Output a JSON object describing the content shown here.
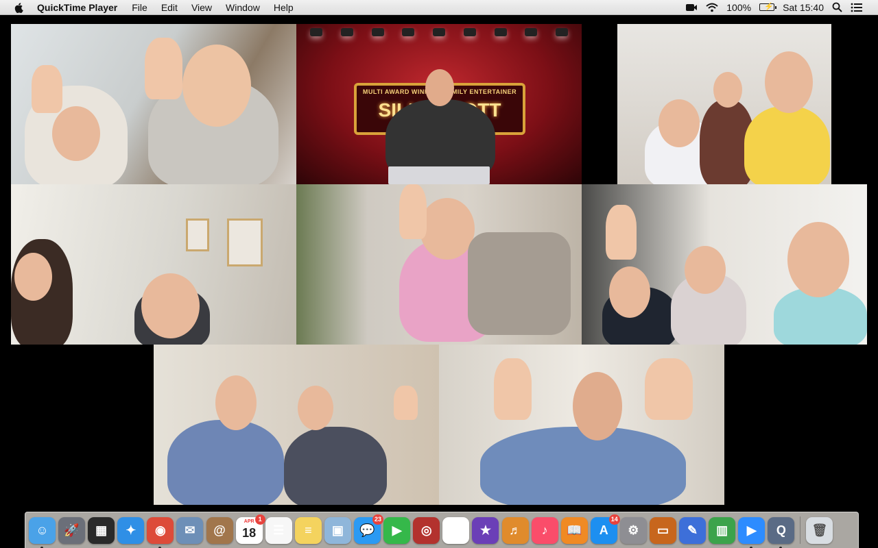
{
  "menubar": {
    "app_name": "QuickTime Player",
    "menus": [
      "File",
      "Edit",
      "View",
      "Window",
      "Help"
    ],
    "battery_percent": "100%",
    "clock": "Sat 15:40"
  },
  "video_tiles": {
    "entertainer_banner_line1": "MULTI AWARD WINNING FAMILY ENTERTAINER",
    "entertainer_banner_line2": "SILLY SCOTT"
  },
  "dock": {
    "items": [
      {
        "name": "finder-icon",
        "color": "#4aa2e8",
        "glyph": "☺",
        "running": true
      },
      {
        "name": "launchpad-icon",
        "color": "#6b6f79",
        "glyph": "🚀",
        "running": false
      },
      {
        "name": "mission-control-icon",
        "color": "#2a2a2a",
        "glyph": "▦",
        "running": false
      },
      {
        "name": "safari-icon",
        "color": "#2f8fe6",
        "glyph": "✦",
        "running": false
      },
      {
        "name": "chrome-icon",
        "color": "#dd4b39",
        "glyph": "◉",
        "running": true
      },
      {
        "name": "mail-stamp-icon",
        "color": "#6d8fb7",
        "glyph": "✉",
        "running": false
      },
      {
        "name": "contacts-icon",
        "color": "#a1764c",
        "glyph": "@",
        "running": false
      },
      {
        "name": "calendar-icon",
        "color": "#ffffff",
        "glyph": "",
        "running": false,
        "badge": "1"
      },
      {
        "name": "reminders-icon",
        "color": "#f7f7f7",
        "glyph": "☰",
        "running": false
      },
      {
        "name": "notes-icon",
        "color": "#f4d35e",
        "glyph": "≡",
        "running": false
      },
      {
        "name": "preview-icon",
        "color": "#8fb6da",
        "glyph": "▣",
        "running": false
      },
      {
        "name": "messages-icon",
        "color": "#2b9af3",
        "glyph": "💬",
        "running": false,
        "badge": "23"
      },
      {
        "name": "facetime-icon",
        "color": "#35b84a",
        "glyph": "▶",
        "running": false
      },
      {
        "name": "photo-booth-icon",
        "color": "#b3322e",
        "glyph": "◎",
        "running": false
      },
      {
        "name": "photos-icon",
        "color": "#ffffff",
        "glyph": "✿",
        "running": false
      },
      {
        "name": "imovie-icon",
        "color": "#6b3fb7",
        "glyph": "★",
        "running": false
      },
      {
        "name": "garageband-icon",
        "color": "#e08b2c",
        "glyph": "♬",
        "running": false
      },
      {
        "name": "music-icon",
        "color": "#fa4d6a",
        "glyph": "♪",
        "running": false
      },
      {
        "name": "books-icon",
        "color": "#f08a24",
        "glyph": "📖",
        "running": false
      },
      {
        "name": "app-store-icon",
        "color": "#1d8ff0",
        "glyph": "A",
        "running": false,
        "badge": "14"
      },
      {
        "name": "system-preferences-icon",
        "color": "#8e8e93",
        "glyph": "⚙",
        "running": false
      },
      {
        "name": "keynote-icon",
        "color": "#c7661d",
        "glyph": "▭",
        "running": false
      },
      {
        "name": "xcode-icon",
        "color": "#3d6fd9",
        "glyph": "✎",
        "running": false
      },
      {
        "name": "numbers-icon",
        "color": "#3ca34b",
        "glyph": "▥",
        "running": false
      },
      {
        "name": "zoom-icon",
        "color": "#2d8cff",
        "glyph": "▶",
        "running": true
      },
      {
        "name": "quicktime-icon",
        "color": "#5a6b85",
        "glyph": "Q",
        "running": true
      }
    ],
    "calendar_month": "APR",
    "calendar_day": "18",
    "trash": {
      "name": "trash-icon",
      "color": "#d8dde2",
      "glyph": "🗑"
    }
  },
  "colors": {
    "menubar_bg": "#e6e6e6",
    "dock_bg": "#c8c4be",
    "badge_red": "#e8433d"
  }
}
